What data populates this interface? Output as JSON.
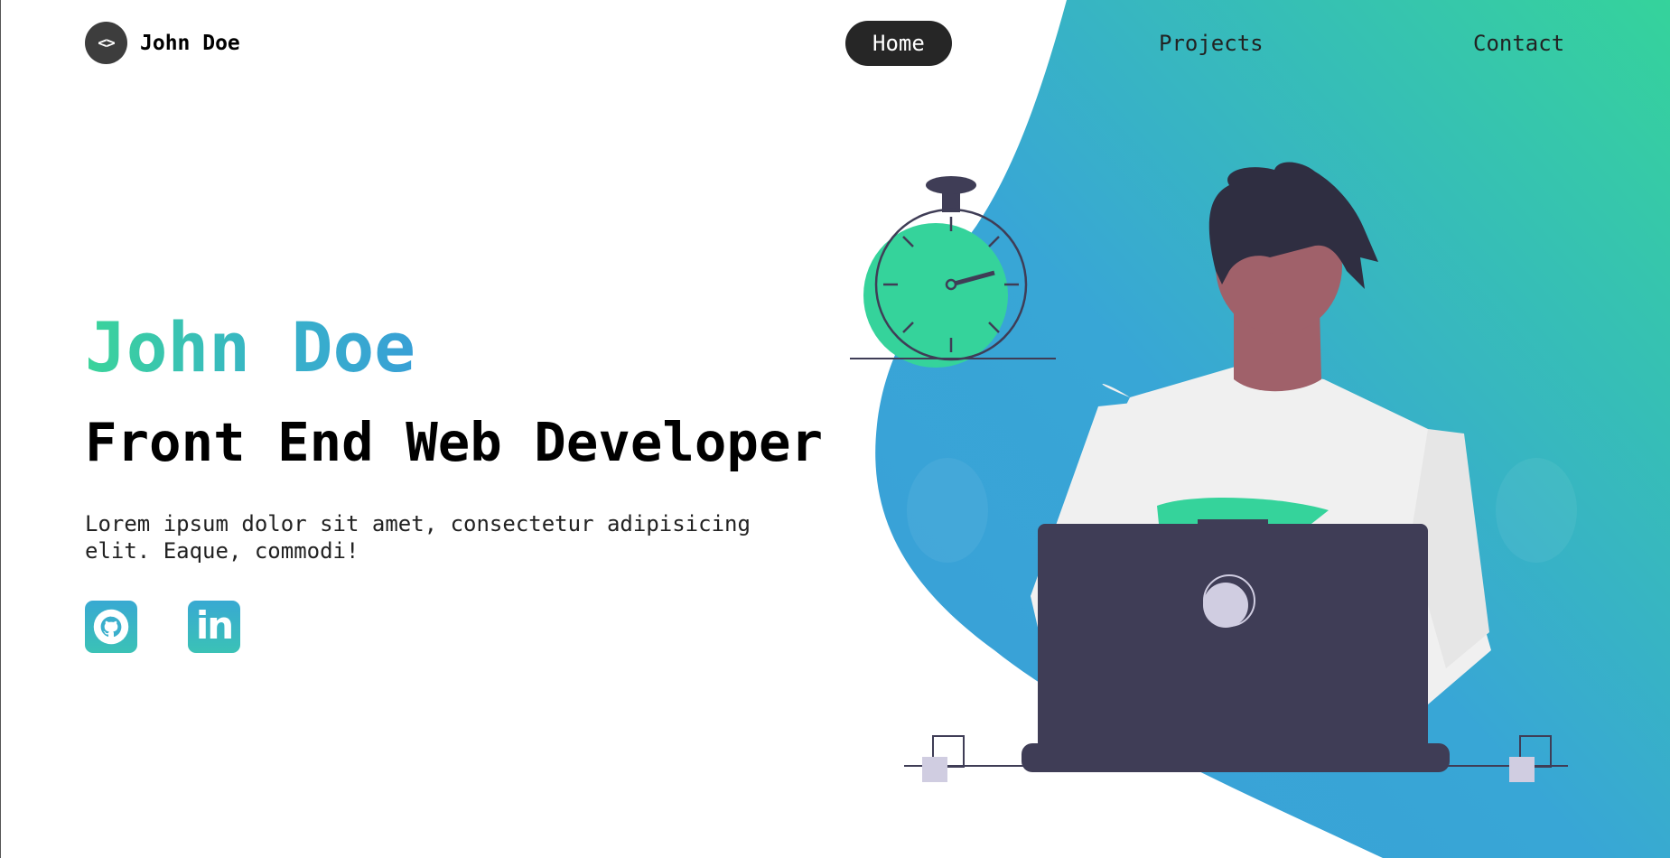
{
  "brand": {
    "logo_glyph": "<>",
    "name": "John Doe"
  },
  "nav": {
    "items": [
      {
        "label": "Home",
        "active": true
      },
      {
        "label": "Projects",
        "active": false
      },
      {
        "label": "Contact",
        "active": false
      }
    ]
  },
  "hero": {
    "name": "John Doe",
    "title": "Front End Web Developer",
    "description": "Lorem ipsum dolor sit amet, consectetur adipisicing elit. Eaque, commodi!"
  },
  "social": {
    "github_icon": "github-icon",
    "linkedin_icon": "linkedin-icon",
    "linkedin_glyph": "in"
  },
  "colors": {
    "gradient_green": "#35d39b",
    "gradient_blue": "#38a0d6",
    "dark": "#262626",
    "laptop": "#3f3d56",
    "skin": "#a0616a",
    "shirt": "#f0f0f0"
  }
}
